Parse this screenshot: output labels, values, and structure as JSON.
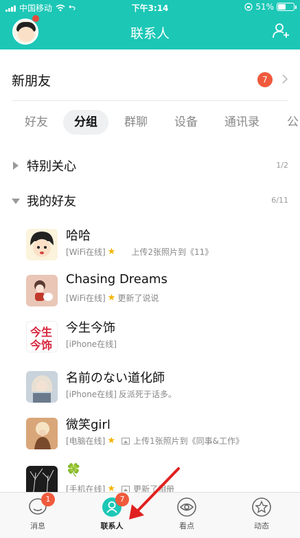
{
  "status_bar": {
    "carrier": "中国移动",
    "time": "下午3:14",
    "battery": "51%"
  },
  "header": {
    "title": "联系人"
  },
  "new_friends": {
    "label": "新朋友",
    "badge": "7"
  },
  "tabs": [
    {
      "label": "好友"
    },
    {
      "label": "分组"
    },
    {
      "label": "群聊"
    },
    {
      "label": "设备"
    },
    {
      "label": "通讯录"
    },
    {
      "label": "公"
    }
  ],
  "groups": {
    "special": {
      "name": "特别关心",
      "count": "1/2"
    },
    "friends": {
      "name": "我的好友",
      "count": "6/11"
    }
  },
  "friends": [
    {
      "name": "哈哈",
      "status": "[WiFi在线]",
      "note": "上传2张照片到《11》"
    },
    {
      "name": "Chasing Dreams",
      "status": "[WiFi在线]",
      "note": "更新了说说"
    },
    {
      "name": "今生今饰",
      "status": "[iPhone在线]",
      "note": ""
    },
    {
      "name": "名前のない道化師",
      "status": "[iPhone在线]",
      "note": "反派死于话多。"
    },
    {
      "name": "微笑girl",
      "status": "[电脑在线]",
      "note": "上传1张照片到《同事&工作》"
    },
    {
      "name": "🍀",
      "status": "[手机在线]",
      "note": "更新了相册"
    }
  ],
  "avatar_text": {
    "jinsheng": "今生今饰"
  },
  "bottom_nav": [
    {
      "label": "消息",
      "badge": "1"
    },
    {
      "label": "联系人",
      "badge": "7"
    },
    {
      "label": "看点",
      "badge": ""
    },
    {
      "label": "动态",
      "badge": ""
    }
  ],
  "colors": {
    "accent": "#1cc7b6",
    "badge": "#f05a3c",
    "star": "#f4b400",
    "annotation_arrow": "#e02020"
  }
}
